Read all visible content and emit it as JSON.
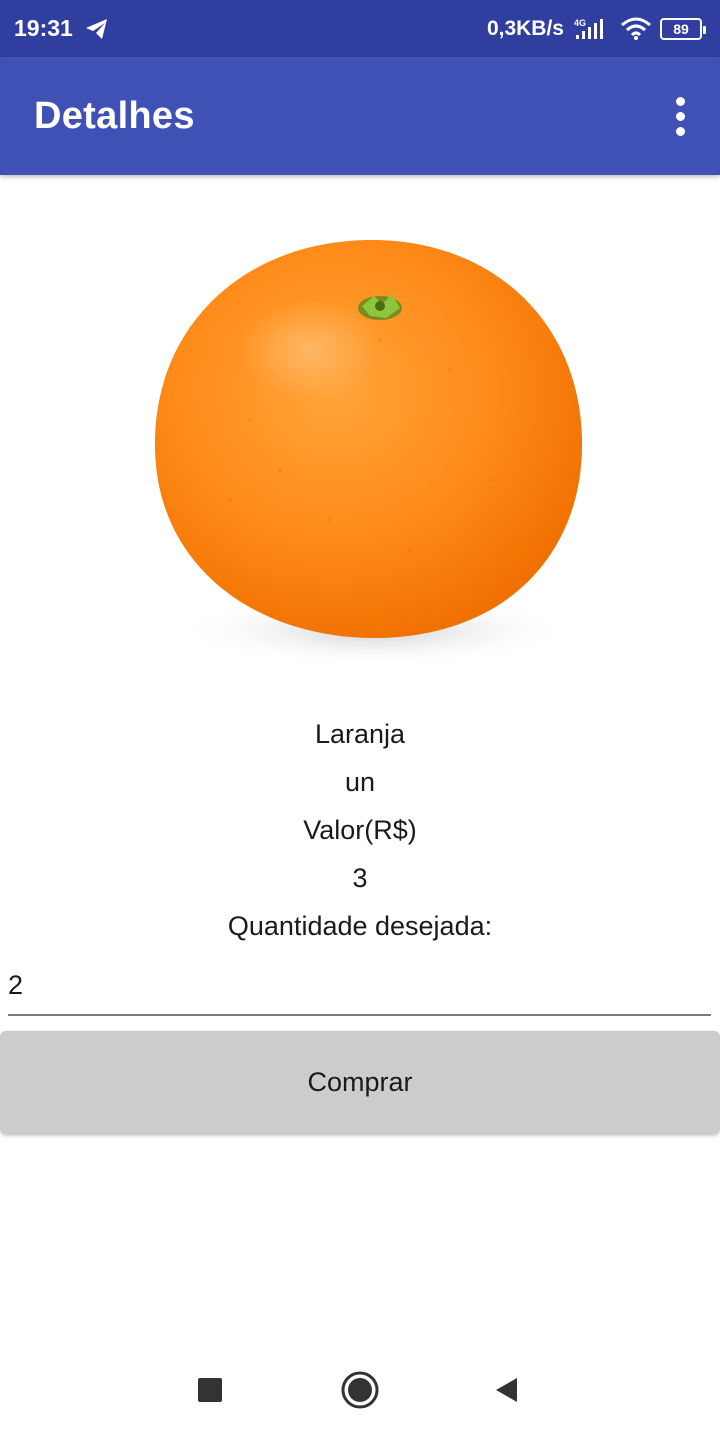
{
  "status_bar": {
    "time": "19:31",
    "net_speed": "0,3KB/s",
    "network_type": "4G",
    "battery": "89",
    "icons": [
      "telegram-icon",
      "signal-icon",
      "wifi-icon",
      "battery-icon"
    ]
  },
  "app_bar": {
    "title": "Detalhes",
    "menu_icon": "more-vert-icon",
    "background": "#3f51b5",
    "status_background": "#303f9f"
  },
  "product": {
    "image": "orange-fruit",
    "name": "Laranja",
    "unit": "un",
    "price_label": "Valor(R$)",
    "price": "3",
    "quantity_label": "Quantidade desejada:"
  },
  "form": {
    "quantity_value": "2"
  },
  "actions": {
    "buy_label": "Comprar"
  },
  "nav_bar": {
    "icons": [
      "recent-apps-icon",
      "home-icon",
      "back-icon"
    ]
  }
}
